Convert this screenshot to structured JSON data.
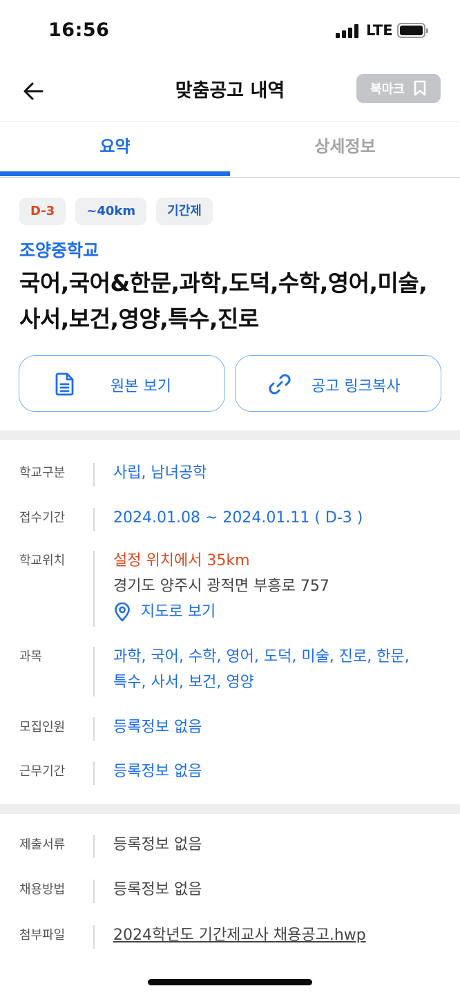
{
  "status_bar": {
    "time": "16:56",
    "network": "LTE"
  },
  "header": {
    "title": "맞춤공고 내역",
    "bookmark_label": "북마크"
  },
  "tabs": [
    {
      "label": "요약",
      "active": true
    },
    {
      "label": "상세정보",
      "active": false
    }
  ],
  "chips": {
    "dday": "D-3",
    "distance": "~40km",
    "type": "기간제"
  },
  "school_name": "조양중학교",
  "subjects_title": "국어,국어&한문,과학,도덕,수학,영어,미술,사서,보건,영양,특수,진로",
  "actions": {
    "original": "원본 보기",
    "copy_link": "공고 링크복사"
  },
  "info": {
    "school_type": {
      "label": "학교구분",
      "value": "사립, 남녀공학"
    },
    "period": {
      "label": "접수기간",
      "value": "2024.01.08 ~ 2024.01.11 ( D-3 )"
    },
    "location": {
      "label": "학교위치",
      "distance": "설정 위치에서 35km",
      "address": "경기도 양주시 광적면 부흥로 757",
      "map_link": "지도로 보기"
    },
    "subjects": {
      "label": "과목",
      "value_line1": "과학, 국어, 수학, 영어, 도덕, 미술, 진로, 한문,",
      "value_line2": "특수, 사서, 보건, 영양"
    },
    "recruits": {
      "label": "모집인원",
      "value": "등록정보 없음"
    },
    "work_period": {
      "label": "근무기간",
      "value": "등록정보 없음"
    }
  },
  "docs": {
    "documents": {
      "label": "제출서류",
      "value": "등록정보 없음"
    },
    "method": {
      "label": "채용방법",
      "value": "등록정보 없음"
    },
    "attachment": {
      "label": "첨부파일",
      "file": "2024학년도 기간제교사 채용공고.hwp"
    }
  },
  "colors": {
    "accent": "#1e6ee8",
    "warning": "#e0491f",
    "divider": "#eeeeee"
  }
}
